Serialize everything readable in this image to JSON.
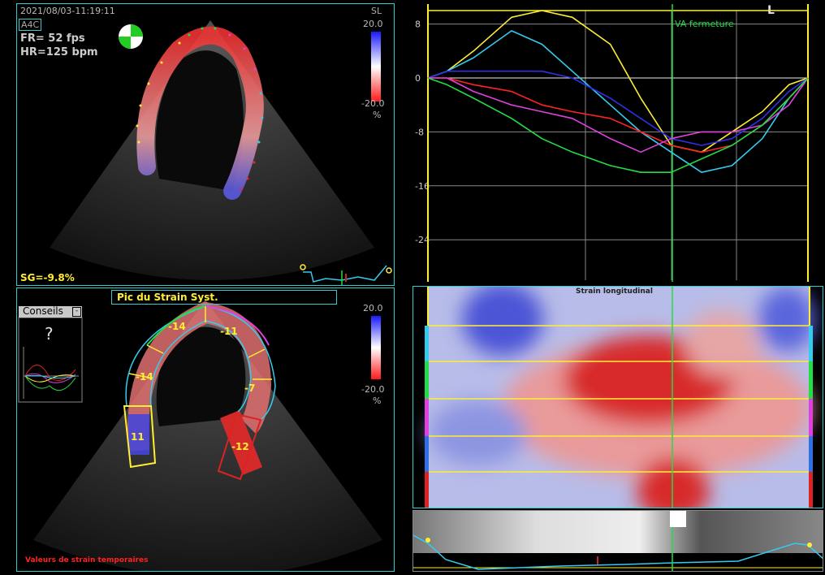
{
  "top_left": {
    "timestamp": "2021/08/03-11:19:11",
    "view": "A4C",
    "fr": "FR= 52 fps",
    "hr": "HR=125 bpm",
    "mode": "SL",
    "scale_max": "20.0",
    "scale_min": "-20.0",
    "unit": "%",
    "sg": "SG=-9.8%"
  },
  "bottom_left": {
    "title": "Pic du Strain Syst.",
    "conseils": "Conseils",
    "help": "?",
    "scale_max": "20.0",
    "scale_min": "-20.0",
    "unit": "%",
    "footer": "Valeurs de strain temporaires",
    "segments": [
      "-14",
      "-11",
      "-14",
      "-7",
      "11",
      "-12"
    ]
  },
  "top_right": {
    "label_l": "L",
    "marker": "VA fermeture"
  },
  "bottom_right": {
    "title": "Strain longitudinal"
  },
  "chart_data": {
    "type": "line",
    "ylim": [
      -30,
      10
    ],
    "y_ticks": [
      "8",
      "0",
      "-8",
      "-16",
      "-24"
    ],
    "grid": true,
    "series": [
      {
        "color": "#ffee33",
        "x": [
          0,
          0.05,
          0.12,
          0.22,
          0.3,
          0.38,
          0.48,
          0.56,
          0.64,
          0.72,
          0.8,
          0.88,
          0.95,
          1
        ],
        "y": [
          0,
          1,
          4,
          9,
          10,
          9,
          5,
          -3,
          -10,
          -11,
          -8,
          -5,
          -1,
          0
        ]
      },
      {
        "color": "#33ccee",
        "x": [
          0,
          0.05,
          0.12,
          0.22,
          0.3,
          0.38,
          0.48,
          0.56,
          0.64,
          0.72,
          0.8,
          0.88,
          0.95,
          1
        ],
        "y": [
          0,
          1,
          3,
          7,
          5,
          1,
          -4,
          -8,
          -11,
          -14,
          -13,
          -9,
          -3,
          0
        ]
      },
      {
        "color": "#2f2fe8",
        "x": [
          0,
          0.05,
          0.12,
          0.22,
          0.3,
          0.38,
          0.48,
          0.56,
          0.64,
          0.72,
          0.8,
          0.88,
          0.95,
          1
        ],
        "y": [
          0,
          1,
          1,
          1,
          1,
          0,
          -3,
          -6,
          -9,
          -10,
          -9,
          -6,
          -2,
          0
        ]
      },
      {
        "color": "#ff2222",
        "x": [
          0,
          0.05,
          0.12,
          0.22,
          0.3,
          0.38,
          0.48,
          0.56,
          0.64,
          0.72,
          0.8,
          0.88,
          0.95,
          1
        ],
        "y": [
          0,
          0,
          -1,
          -2,
          -4,
          -5,
          -6,
          -8,
          -10,
          -11,
          -10,
          -7,
          -3,
          0
        ]
      },
      {
        "color": "#e040e0",
        "x": [
          0,
          0.05,
          0.12,
          0.22,
          0.3,
          0.38,
          0.48,
          0.56,
          0.64,
          0.72,
          0.8,
          0.88,
          0.95,
          1
        ],
        "y": [
          0,
          0,
          -2,
          -4,
          -5,
          -6,
          -9,
          -11,
          -9,
          -8,
          -8,
          -7,
          -4,
          0
        ]
      },
      {
        "color": "#22dd44",
        "x": [
          0,
          0.05,
          0.12,
          0.22,
          0.3,
          0.38,
          0.48,
          0.56,
          0.64,
          0.72,
          0.8,
          0.88,
          0.95,
          1
        ],
        "y": [
          0,
          -1,
          -3,
          -6,
          -9,
          -11,
          -13,
          -14,
          -14,
          -12,
          -10,
          -7,
          -3,
          0
        ]
      }
    ]
  },
  "colors": {
    "border": "#33cccc",
    "label_yellow": "#ffee33",
    "marker_green": "#22dd44",
    "footer_red": "#ff2222"
  }
}
